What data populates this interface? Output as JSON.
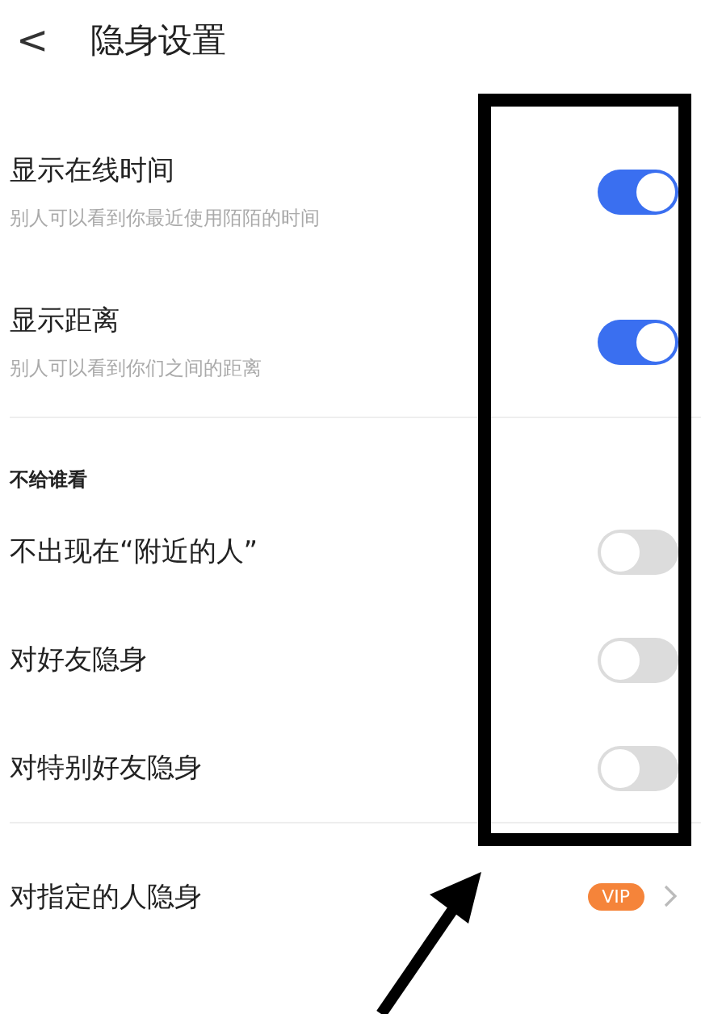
{
  "header": {
    "back_icon": "<",
    "title": "隐身设置"
  },
  "settings": [
    {
      "title": "显示在线时间",
      "subtitle": "别人可以看到你最近使用陌陌的时间",
      "on": true
    },
    {
      "title": "显示距离",
      "subtitle": "别人可以看到你们之间的距离",
      "on": true
    }
  ],
  "hide_from": {
    "heading": "不给谁看",
    "items": [
      {
        "title": "不出现在“附近的人”",
        "on": false
      },
      {
        "title": "对好友隐身",
        "on": false
      },
      {
        "title": "对特别好友隐身",
        "on": false
      }
    ]
  },
  "specific": {
    "title": "对指定的人隐身",
    "badge": "VIP"
  }
}
